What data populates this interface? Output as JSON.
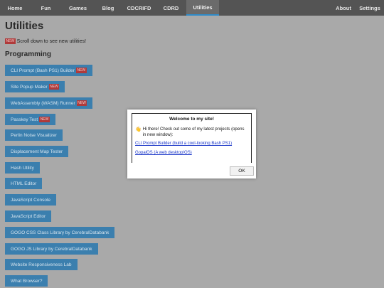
{
  "nav": {
    "left": [
      "Home",
      "Fun",
      "Games",
      "Blog",
      "CDCRIFD",
      "CDRD",
      "Utilities"
    ],
    "active": "Utilities",
    "right": [
      "About",
      "Settings"
    ]
  },
  "page": {
    "title": "Utilities",
    "badge": "NEW",
    "notice": "Scroll down to see new utilities!",
    "section": "Programming"
  },
  "utilities": [
    {
      "label": "CLI Prompt (Bash PS1) Builder",
      "new": "NEW"
    },
    {
      "label": "Site Popup Maker",
      "new": "NEW"
    },
    {
      "label": "WebAssembly (WASM) Runner",
      "new": "NEW"
    },
    {
      "label": "Passkey Test",
      "new": "NEW"
    },
    {
      "label": "Perlin Noise Visualizer"
    },
    {
      "label": "Displacement Map Tester"
    },
    {
      "label": "Hash Utility"
    },
    {
      "label": "HTML Editor"
    },
    {
      "label": "JavaScript Console"
    },
    {
      "label": "JavaScript Editor"
    },
    {
      "label": "GOGO CSS Class Library by CerebralDatabank"
    },
    {
      "label": "GOGO JS Library by CerebralDatabank"
    },
    {
      "label": "Website Responsiveness Lab"
    },
    {
      "label": "What Browser?"
    }
  ],
  "modal": {
    "title": "Welcome to my site!",
    "text": "Hi there! Check out some of my latest projects (opens in new window):",
    "links": [
      "CLI Prompt Builder (build a cool-looking Bash PS1)",
      "GopalOS (A web desktop/OS)"
    ],
    "ok": "OK"
  }
}
